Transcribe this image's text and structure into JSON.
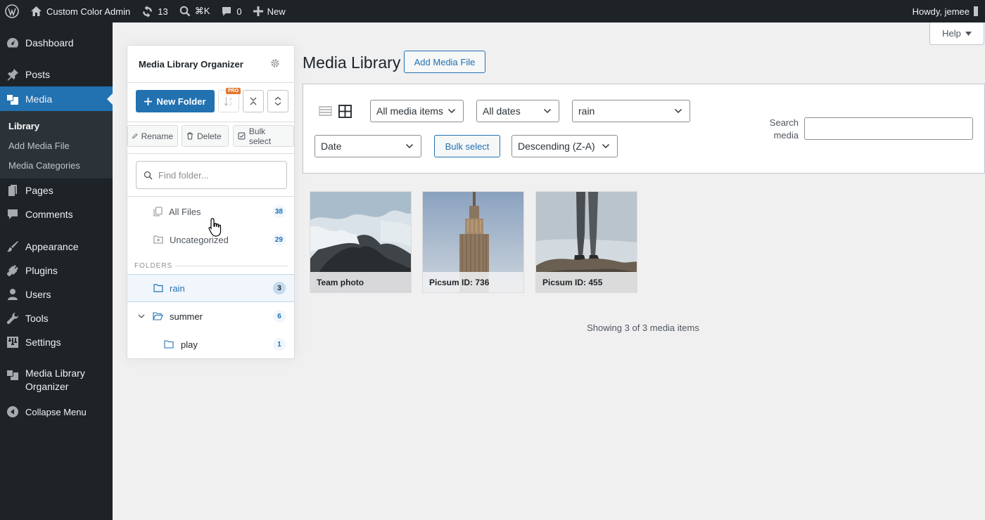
{
  "adminbar": {
    "site_name": "Custom Color Admin",
    "updates_count": "13",
    "search_shortcut": "⌘K",
    "comments_count": "0",
    "new_label": "New",
    "howdy": "Howdy, jemee"
  },
  "sidebar": {
    "items": [
      {
        "label": "Dashboard",
        "icon": "dashboard-icon"
      },
      {
        "label": "Posts",
        "icon": "pushpin-icon"
      },
      {
        "label": "Media",
        "icon": "media-icon"
      },
      {
        "label": "Pages",
        "icon": "page-icon"
      },
      {
        "label": "Comments",
        "icon": "comment-icon"
      },
      {
        "label": "Appearance",
        "icon": "brush-icon"
      },
      {
        "label": "Plugins",
        "icon": "plug-icon"
      },
      {
        "label": "Users",
        "icon": "user-icon"
      },
      {
        "label": "Tools",
        "icon": "wrench-icon"
      },
      {
        "label": "Settings",
        "icon": "sliders-icon"
      },
      {
        "label": "Media Library Organizer",
        "icon": "media-icon"
      },
      {
        "label": "Collapse Menu",
        "icon": "collapse-icon"
      }
    ],
    "submenu": [
      "Library",
      "Add Media File",
      "Media Categories"
    ],
    "accent_color": "#2271b1"
  },
  "help": {
    "label": "Help"
  },
  "organizer": {
    "title": "Media Library Organizer",
    "new_folder": "New Folder",
    "pro_badge": "PRO",
    "rename": "Rename",
    "delete": "Delete",
    "bulk_select": "Bulk select",
    "find_placeholder": "Find folder...",
    "all_files": {
      "label": "All Files",
      "count": "38"
    },
    "uncategorized": {
      "label": "Uncategorized",
      "count": "29"
    },
    "folders_label": "FOLDERS",
    "folders": [
      {
        "label": "rain",
        "count": "3"
      },
      {
        "label": "summer",
        "count": "6"
      },
      {
        "label": "play",
        "count": "1"
      }
    ]
  },
  "main": {
    "title": "Media Library",
    "add_media": "Add Media File",
    "filters": {
      "type": "All media items",
      "dates": "All dates",
      "category": "rain",
      "orderby": "Date",
      "order": "Descending (Z-A)"
    },
    "bulk_select": "Bulk select",
    "search_label": "Search media",
    "search_value": "",
    "items": [
      {
        "caption": "Team photo"
      },
      {
        "caption": "Picsum ID: 736"
      },
      {
        "caption": "Picsum ID: 455"
      }
    ],
    "showing": "Showing 3 of 3 media items"
  }
}
